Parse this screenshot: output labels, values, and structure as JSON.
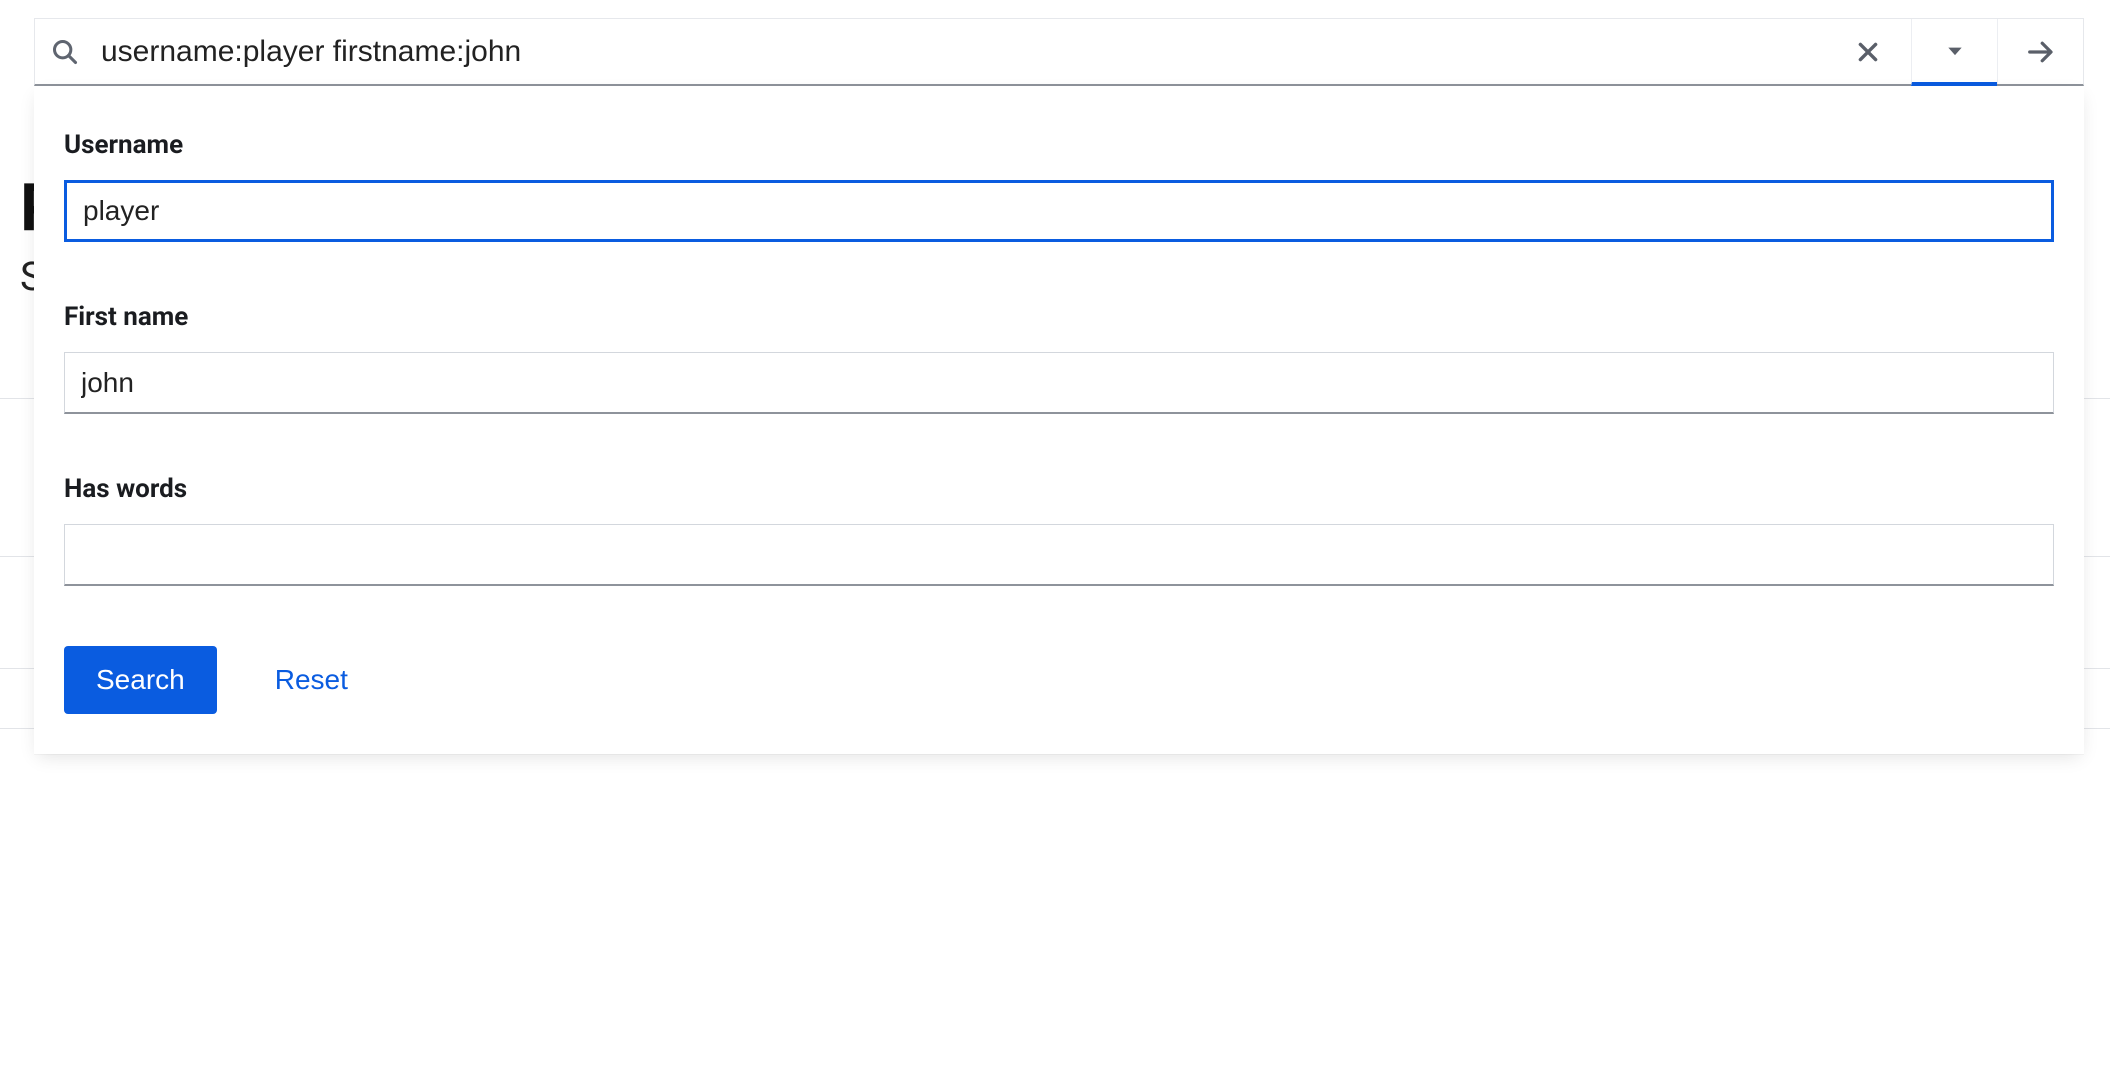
{
  "background": {
    "title_fragment": "P",
    "subtitle_fragment": "Se"
  },
  "searchbar": {
    "query": "username:player firstname:john"
  },
  "panel": {
    "fields": {
      "username": {
        "label": "Username",
        "value": "player"
      },
      "firstname": {
        "label": "First name",
        "value": "john"
      },
      "haswords": {
        "label": "Has words",
        "value": ""
      }
    },
    "actions": {
      "search_label": "Search",
      "reset_label": "Reset"
    }
  }
}
